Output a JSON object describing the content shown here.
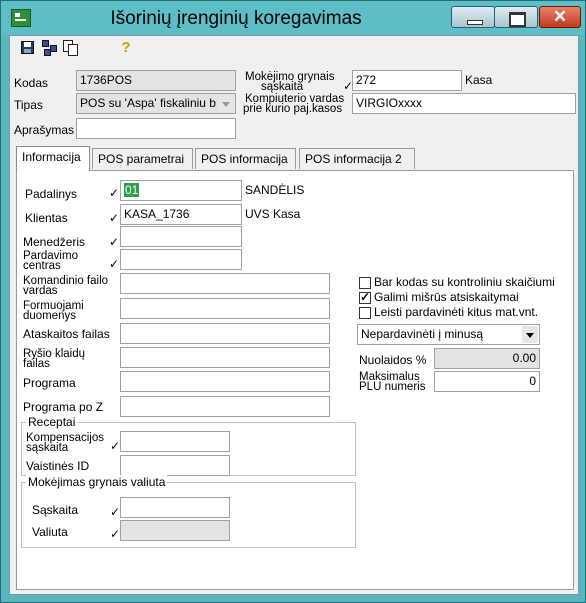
{
  "window": {
    "title": "Išorinių įrenginių koregavimas"
  },
  "header": {
    "kodas_label": "Kodas",
    "kodas_value": "1736POS",
    "tipas_label": "Tipas",
    "tipas_value": "POS su 'Aspa' fiskaliniu b",
    "aprasymas_label": "Aprašymas",
    "aprasymas_value": "",
    "moketimo_label_1": "Mokėjimo grynais",
    "moketimo_label_2": "sąskaita",
    "moketimo_value": "272",
    "moketimo_desc": "Kasa",
    "komp_label_1": "Kompiuterio vardas",
    "komp_label_2": "prie kurio paj.kasos",
    "komp_value": "VIRGIOxxxx"
  },
  "tabs": [
    "Informacija",
    "POS parametrai",
    "POS informacija",
    "POS informacija 2"
  ],
  "form": {
    "padalinys_label": "Padalinys",
    "padalinys_value": "01",
    "padalinys_desc": "SANDĖLIS",
    "klientas_label": "Klientas",
    "klientas_value": "KASA_1736",
    "klientas_desc": "UVS Kasa",
    "menedzeris_label": "Menedžeris",
    "pardavimo_label_1": "Pardavimo",
    "pardavimo_label_2": "centras",
    "komandinio_label_1": "Komandinio failo",
    "komandinio_label_2": "vardas",
    "formuojami_label_1": "Formuojami",
    "formuojami_label_2": "duomenys",
    "ataskaitos_label": "Ataskaitos failas",
    "rysio_label_1": "Ryšio klaidų",
    "rysio_label_2": "failas",
    "programa_label": "Programa",
    "programa_po_z_label": "Programa po Z",
    "receptai_label": "Receptai",
    "kompensacijos_label_1": "Kompensacijos",
    "kompensacijos_label_2": "sąskaita",
    "vaistines_label": "Vaistinės ID",
    "moketimas_group_label": "Mokėjimas grynais valiuta",
    "saskaita_label": "Sąskaita",
    "valiuta_label": "Valiuta"
  },
  "options": {
    "barkodas_label": "Bar kodas su kontroliniu skaičiumi",
    "barkodas_checked": false,
    "misrus_label": "Galimi mišrūs atsiskaitymai",
    "misrus_checked": true,
    "leisti_label": "Leisti pardavinėti kitus mat.vnt.",
    "leisti_checked": false,
    "minus_value": "Nepardavinėti į minusą",
    "nuolaidos_label": "Nuolaidos %",
    "nuolaidos_value": "0.00",
    "maks_label_1": "Maksimalus",
    "maks_label_2": "PLU numeris",
    "maks_value": "0"
  },
  "marks": {
    "check": "✓"
  },
  "colors": {
    "titlebar": "#5cbfc8",
    "selection": "#2e9e4a",
    "close": "#c43a1c"
  }
}
